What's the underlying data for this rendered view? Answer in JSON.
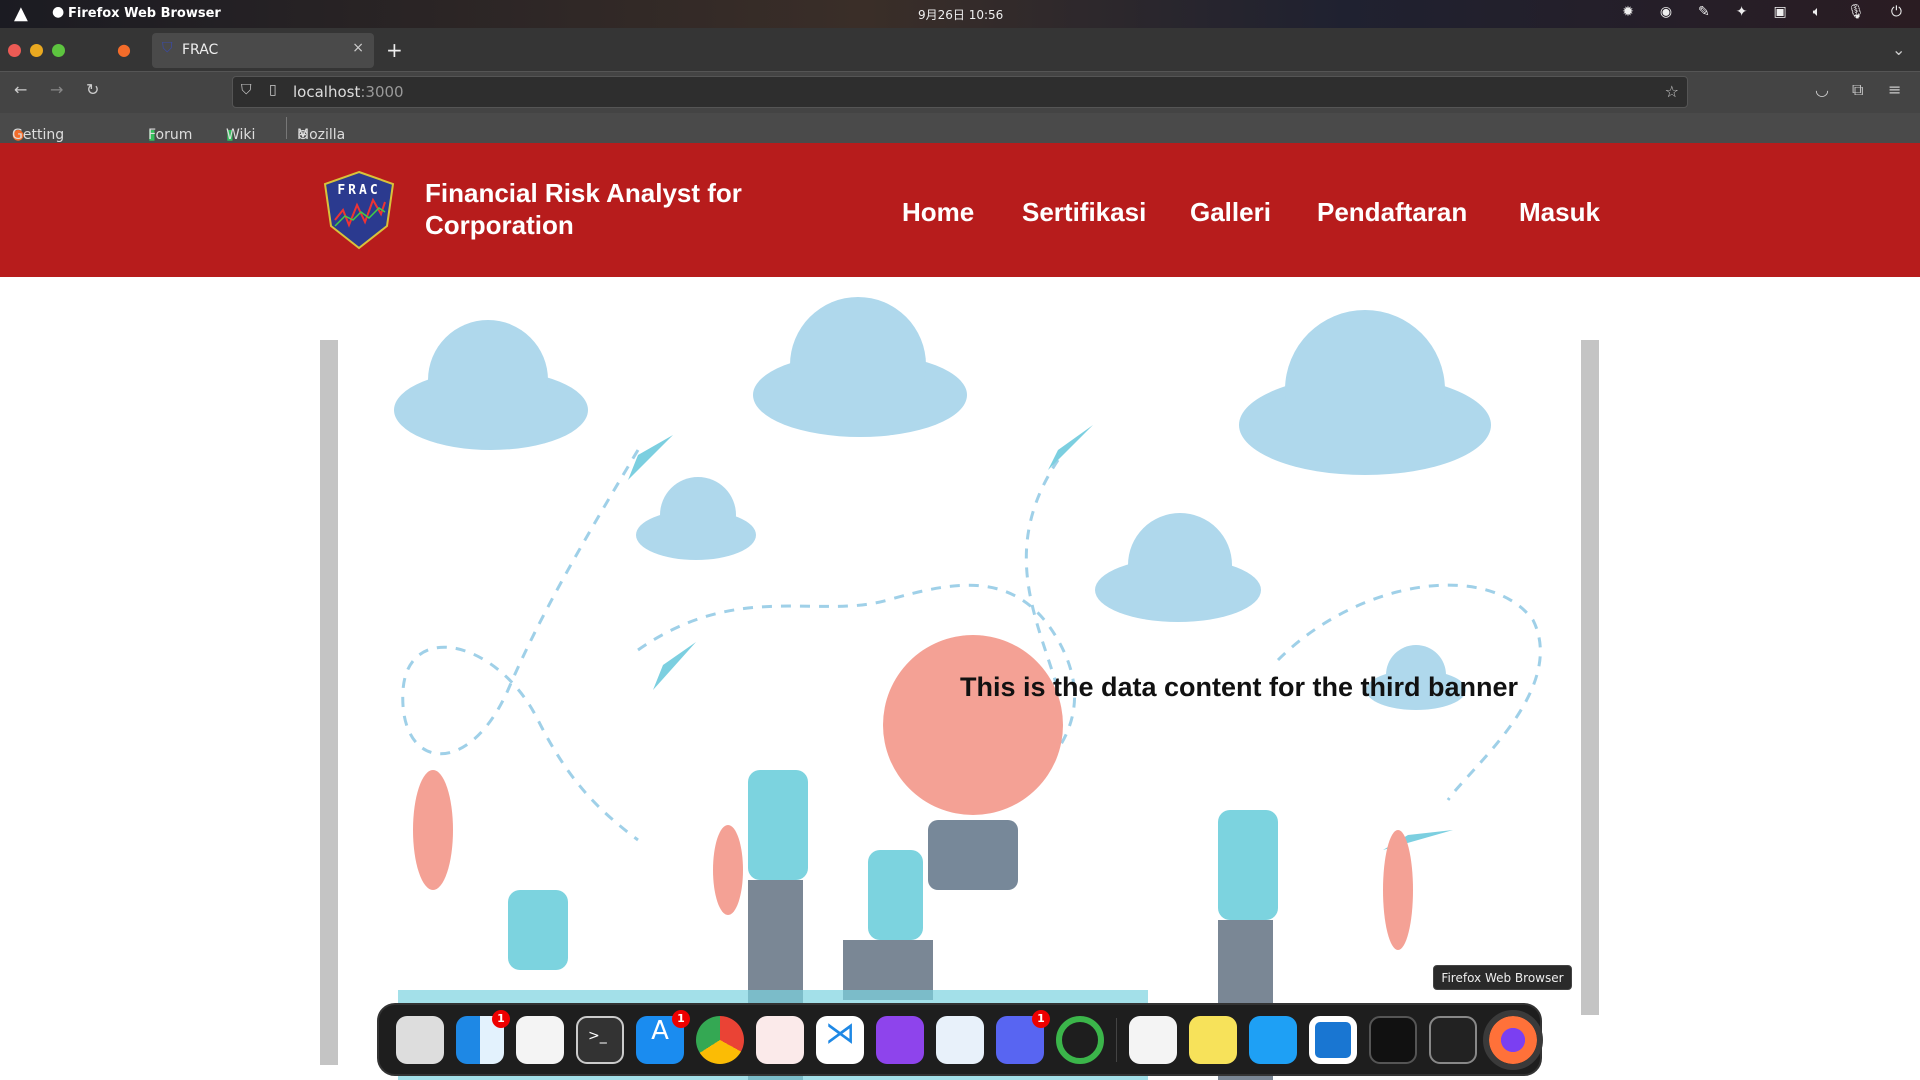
{
  "system": {
    "app_name": "Firefox Web Browser",
    "clock": "9月26日  10:56"
  },
  "browser": {
    "tab_title": "FRAC",
    "url_host": "localhost",
    "url_port": ":3000",
    "bookmarks": [
      "Getting Started",
      "Forum",
      "Wiki",
      "Mozilla News"
    ]
  },
  "site": {
    "title": "Financial Risk Analyst for Corporation",
    "logo_text": "FRAC",
    "nav": [
      "Home",
      "Sertifikasi",
      "Galleri",
      "Pendaftaran",
      "Masuk"
    ],
    "brand_color": "#b71c1c"
  },
  "banner": {
    "text": "This is the data content for the third banner"
  },
  "dock": {
    "tooltip": "Firefox Web Browser",
    "badges": {
      "finder": "1",
      "appstore": "1",
      "discord": "1"
    }
  }
}
